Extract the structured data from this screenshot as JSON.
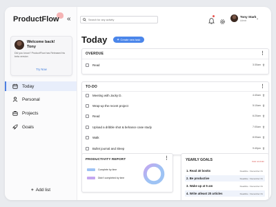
{
  "app": {
    "name": "ProductFlow"
  },
  "welcome": {
    "title_line1": "Welcome back!",
    "title_line2": "Tony",
    "body": "Did you know? ProductFlow has Released his beta version",
    "link": "Try Now"
  },
  "sidebar": {
    "items": [
      {
        "label": "Today",
        "icon": "calendar-icon",
        "active": true
      },
      {
        "label": "Personal",
        "icon": "person-icon"
      },
      {
        "label": "Projects",
        "icon": "briefcase-icon"
      },
      {
        "label": "Goals",
        "icon": "rocket-icon"
      }
    ],
    "add_list": "Add list"
  },
  "header": {
    "search_placeholder": "Search for any activity",
    "user_name": "Tony Stark",
    "user_role": "Admin"
  },
  "main": {
    "title": "Today",
    "create_button": "Create new task"
  },
  "overdue": {
    "title": "OVERDUE",
    "tasks": [
      {
        "title": "Read",
        "time": "3:30am"
      }
    ]
  },
  "todo": {
    "title": "TO-DO",
    "tasks": [
      {
        "title": "Meeting with Jacky D.",
        "time": "4:40am"
      },
      {
        "title": "Wrap-up the recent project",
        "time": "5:10am"
      },
      {
        "title": "Read",
        "time": "6:20am"
      },
      {
        "title": "Upload a dribble shot & behance case study",
        "time": "7:00am"
      },
      {
        "title": "Walk",
        "time": "8:00am"
      },
      {
        "title": "Bullet journal and Sleep",
        "time": "9:40pm"
      }
    ]
  },
  "productivity": {
    "title": "PRODUCTIVITY REPORT",
    "legend": [
      {
        "label": "Complete by time",
        "color": "#9ec3f4"
      },
      {
        "label": "Didn't completed by time",
        "color": "#c4a6f0"
      }
    ],
    "colors": {
      "blue": "#9ec3f4",
      "purple": "#c4a6f0"
    }
  },
  "goals": {
    "title": "YEARLY GOALS",
    "badge": "Date reminder",
    "items": [
      {
        "label": "1.  Read 40 books",
        "deadline": "Deadline : December 31"
      },
      {
        "label": "2.  Be productive",
        "deadline": "Deadline : December 31"
      },
      {
        "label": "3.  Wake up at 5 am",
        "deadline": "Deadline : December 31"
      },
      {
        "label": "4.  Write atleast 20 articles",
        "deadline": "Deadline : December 31"
      }
    ]
  },
  "colors": {
    "accent": "#4b86ea",
    "active_bg": "#e8eefb",
    "background": "#e9ebef"
  }
}
